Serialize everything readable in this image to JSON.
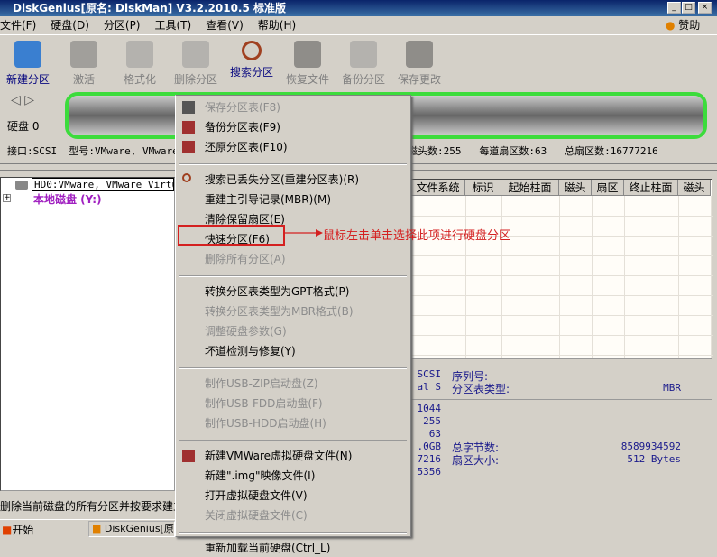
{
  "window": {
    "title": "DiskGenius[原名: DiskMan] V3.2.2010.5 标准版",
    "min": "_",
    "max": "□",
    "close": "×"
  },
  "menubar": [
    "文件(F)",
    "硬盘(D)",
    "分区(P)",
    "工具(T)",
    "查看(V)",
    "帮助(H)"
  ],
  "sponsor": "赞助",
  "toolbar": [
    {
      "label": "新建分区",
      "enabled": true,
      "icon": "laptop-icon"
    },
    {
      "label": "激活",
      "enabled": false,
      "icon": "plug-icon"
    },
    {
      "label": "格式化",
      "enabled": false,
      "icon": "format-icon"
    },
    {
      "label": "删除分区",
      "enabled": false,
      "icon": "trash-icon"
    },
    {
      "label": "搜索分区",
      "enabled": true,
      "icon": "magnifier-icon"
    },
    {
      "label": "恢复文件",
      "enabled": false,
      "icon": "restore-icon"
    },
    {
      "label": "备份分区",
      "enabled": false,
      "icon": "disc-icon"
    },
    {
      "label": "保存更改",
      "enabled": false,
      "icon": "save-icon"
    }
  ],
  "disk": {
    "label": "硬盘 0",
    "info": "接口:SCSI  型号:VMware, VMware V",
    "info_right": "磁头数:255   每道扇区数:63   总扇区数:16777216"
  },
  "tree": {
    "disk": "HD0:VMware, VMware Virtual",
    "local": "本地磁盘 (Y:)"
  },
  "table_headers": [
    "文件系统",
    "标识",
    "起始柱面",
    "磁头",
    "扇区",
    "终止柱面",
    "磁头"
  ],
  "info": {
    "left_values": [
      "SCSI",
      "al S",
      "1044",
      "255",
      "63",
      ".0GB",
      "7216",
      "5356"
    ],
    "serial_label": "序列号:",
    "pt_type_label": "分区表类型:",
    "pt_type": "MBR",
    "total_bytes_label": "总字节数:",
    "total_bytes": "8589934592",
    "sector_size_label": "扇区大小:",
    "sector_size": "512 Bytes"
  },
  "context_menu": [
    {
      "label": "保存分区表(F8)",
      "enabled": false,
      "icon": "save-table-icon"
    },
    {
      "label": "备份分区表(F9)",
      "enabled": true,
      "icon": "backup-table-icon"
    },
    {
      "label": "还原分区表(F10)",
      "enabled": true,
      "icon": "restore-table-icon"
    },
    {
      "sep": true
    },
    {
      "label": "搜索已丢失分区(重建分区表)(R)",
      "enabled": true,
      "icon": "search-icon"
    },
    {
      "label": "重建主引导记录(MBR)(M)",
      "enabled": true
    },
    {
      "label": "清除保留扇区(E)",
      "enabled": true
    },
    {
      "label": "快速分区(F6)",
      "enabled": true,
      "highlight": true
    },
    {
      "label": "删除所有分区(A)",
      "enabled": false
    },
    {
      "sep": true
    },
    {
      "label": "转换分区表类型为GPT格式(P)",
      "enabled": true
    },
    {
      "label": "转换分区表类型为MBR格式(B)",
      "enabled": false
    },
    {
      "label": "调整硬盘参数(G)",
      "enabled": false
    },
    {
      "label": "坏道检测与修复(Y)",
      "enabled": true
    },
    {
      "sep": true
    },
    {
      "label": "制作USB-ZIP启动盘(Z)",
      "enabled": false
    },
    {
      "label": "制作USB-FDD启动盘(F)",
      "enabled": false
    },
    {
      "label": "制作USB-HDD启动盘(H)",
      "enabled": false
    },
    {
      "sep": true
    },
    {
      "label": "新建VMWare虚拟硬盘文件(N)",
      "enabled": true,
      "icon": "vmware-icon"
    },
    {
      "label": "新建\".img\"映像文件(I)",
      "enabled": true
    },
    {
      "label": "打开虚拟硬盘文件(V)",
      "enabled": true
    },
    {
      "label": "关闭虚拟硬盘文件(C)",
      "enabled": false
    },
    {
      "sep": true
    },
    {
      "label": "重新加载当前硬盘(Ctrl_L)",
      "enabled": true
    }
  ],
  "annotation": "鼠标左击单击选择此项进行硬盘分区",
  "status": "删除当前磁盘的所有分区并按要求建立",
  "taskbar": {
    "start": "开始",
    "app": "DiskGenius[原名"
  },
  "colors": {
    "annotation": "#d42020",
    "diskbar_border": "#3cdc3c",
    "title": "#0a246a"
  }
}
